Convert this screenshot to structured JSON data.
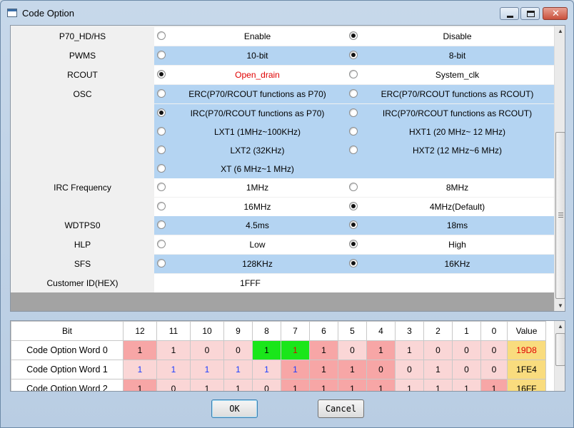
{
  "window": {
    "title": "Code Option"
  },
  "titlebar": {
    "close_glyph": "✕"
  },
  "options": [
    {
      "label": "P70_HD/HS",
      "bg": "white",
      "left": {
        "text": "Enable",
        "checked": false
      },
      "right": {
        "text": "Disable",
        "checked": true
      }
    },
    {
      "label": "PWMS",
      "bg": "blue",
      "left": {
        "text": "10-bit",
        "checked": false
      },
      "right": {
        "text": "8-bit",
        "checked": true
      }
    },
    {
      "label": "RCOUT",
      "bg": "white",
      "left": {
        "text": "Open_drain",
        "checked": true,
        "color": "red"
      },
      "right": {
        "text": "System_clk",
        "checked": false
      }
    },
    {
      "label": "OSC",
      "bg": "blue",
      "left": {
        "text": "ERC(P70/RCOUT functions as P70)",
        "checked": false
      },
      "right": {
        "text": "ERC(P70/RCOUT functions as RCOUT)",
        "checked": false
      }
    },
    {
      "label": "",
      "bg": "blue",
      "left": {
        "text": "IRC(P70/RCOUT functions as P70)",
        "checked": true
      },
      "right": {
        "text": "IRC(P70/RCOUT functions as RCOUT)",
        "checked": false
      }
    },
    {
      "label": "",
      "bg": "blue",
      "left": {
        "text": "LXT1 (1MHz~100KHz)",
        "checked": false
      },
      "right": {
        "text": "HXT1 (20 MHz~ 12 MHz)",
        "checked": false
      }
    },
    {
      "label": "",
      "bg": "blue",
      "left": {
        "text": "LXT2 (32KHz)",
        "checked": false
      },
      "right": {
        "text": "HXT2 (12 MHz~6 MHz)",
        "checked": false
      }
    },
    {
      "label": "",
      "bg": "blue",
      "left": {
        "text": "XT (6 MHz~1 MHz)",
        "checked": false
      },
      "right": null
    },
    {
      "label": "IRC Frequency",
      "bg": "white",
      "left": {
        "text": "1MHz",
        "checked": false
      },
      "right": {
        "text": "8MHz",
        "checked": false
      }
    },
    {
      "label": "",
      "bg": "white",
      "left": {
        "text": "16MHz",
        "checked": false
      },
      "right": {
        "text": "4MHz(Default)",
        "checked": true
      }
    },
    {
      "label": "WDTPS0",
      "bg": "blue",
      "left": {
        "text": "4.5ms",
        "checked": false
      },
      "right": {
        "text": "18ms",
        "checked": true
      }
    },
    {
      "label": "HLP",
      "bg": "white",
      "left": {
        "text": "Low",
        "checked": false
      },
      "right": {
        "text": "High",
        "checked": true
      }
    },
    {
      "label": "SFS",
      "bg": "blue",
      "left": {
        "text": "128KHz",
        "checked": false
      },
      "right": {
        "text": "16KHz",
        "checked": true
      }
    }
  ],
  "customer_id": {
    "label": "Customer ID(HEX)",
    "value": "1FFF"
  },
  "bits_table": {
    "headers": [
      "Bit",
      "12",
      "11",
      "10",
      "9",
      "8",
      "7",
      "6",
      "5",
      "4",
      "3",
      "2",
      "1",
      "0",
      "Value"
    ],
    "rows": [
      {
        "name": "Code Option Word 0",
        "bits": [
          "1",
          "1",
          "0",
          "0",
          "1",
          "1",
          "1",
          "0",
          "1",
          "1",
          "0",
          "0",
          "0"
        ],
        "colors": [
          "pink",
          "lpink",
          "lpink",
          "lpink",
          "green",
          "green",
          "pink",
          "lpink",
          "pink",
          "lpink",
          "lpink",
          "lpink",
          "lpink"
        ],
        "text": [
          "",
          "",
          "",
          "",
          "",
          "red",
          "",
          "",
          "",
          "",
          "",
          "",
          ""
        ],
        "value": "19D8",
        "value_color": "red"
      },
      {
        "name": "Code Option Word 1",
        "bits": [
          "1",
          "1",
          "1",
          "1",
          "1",
          "1",
          "1",
          "1",
          "0",
          "0",
          "1",
          "0",
          "0"
        ],
        "colors": [
          "lpink",
          "lpink",
          "lpink",
          "lpink",
          "lpink",
          "pink",
          "pink",
          "pink",
          "pink",
          "lpink",
          "lpink",
          "lpink",
          "lpink"
        ],
        "text": [
          "blue",
          "blue",
          "blue",
          "blue",
          "blue",
          "blue",
          "",
          "",
          "",
          "",
          "",
          "",
          ""
        ],
        "value": "1FE4",
        "value_color": ""
      },
      {
        "name": "Code Option Word 2",
        "bits": [
          "1",
          "0",
          "1",
          "1",
          "0",
          "1",
          "1",
          "1",
          "1",
          "1",
          "1",
          "1",
          "1"
        ],
        "colors": [
          "pink",
          "lpink",
          "lpink",
          "lpink",
          "lpink",
          "pink",
          "pink",
          "pink",
          "pink",
          "lpink",
          "lpink",
          "lpink",
          "pink"
        ],
        "text": [
          "",
          "",
          "",
          "",
          "",
          "",
          "",
          "",
          "",
          "",
          "",
          "",
          ""
        ],
        "value": "16FF",
        "value_color": ""
      }
    ]
  },
  "buttons": {
    "ok": "OK",
    "cancel": "Cancel"
  },
  "icons": {
    "scroll_up": "▲",
    "scroll_down": "▼"
  }
}
